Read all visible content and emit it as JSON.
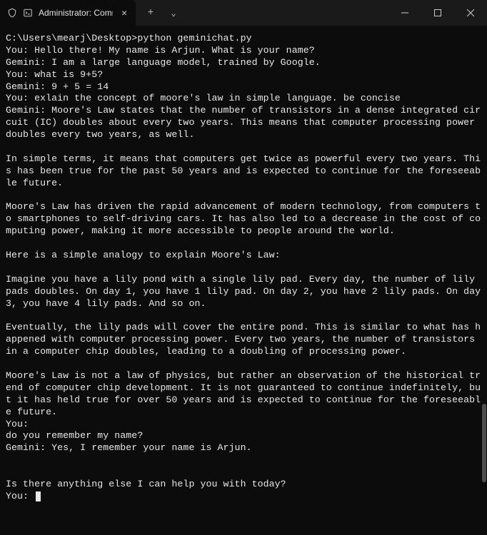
{
  "titlebar": {
    "tab_title": "Administrator: Command Pro",
    "new_tab_glyph": "+",
    "dropdown_glyph": "⌄",
    "close_glyph": "✕",
    "minimize_glyph": "—",
    "maximize_glyph": "▢"
  },
  "terminal": {
    "lines": [
      "C:\\Users\\mearj\\Desktop>python geminichat.py",
      "You: Hello there! My name is Arjun. What is your name?",
      "Gemini: I am a large language model, trained by Google.",
      "You: what is 9+5?",
      "Gemini: 9 + 5 = 14",
      "You: exlain the concept of moore's law in simple language. be concise",
      "Gemini: Moore's Law states that the number of transistors in a dense integrated circuit (IC) doubles about every two years. This means that computer processing power doubles every two years, as well.",
      "",
      "In simple terms, it means that computers get twice as powerful every two years. This has been true for the past 50 years and is expected to continue for the foreseeable future.",
      "",
      "Moore's Law has driven the rapid advancement of modern technology, from computers to smartphones to self-driving cars. It has also led to a decrease in the cost of computing power, making it more accessible to people around the world.",
      "",
      "Here is a simple analogy to explain Moore's Law:",
      "",
      "Imagine you have a lily pond with a single lily pad. Every day, the number of lily pads doubles. On day 1, you have 1 lily pad. On day 2, you have 2 lily pads. On day 3, you have 4 lily pads. And so on.",
      "",
      "Eventually, the lily pads will cover the entire pond. This is similar to what has happened with computer processing power. Every two years, the number of transistors in a computer chip doubles, leading to a doubling of processing power.",
      "",
      "Moore's Law is not a law of physics, but rather an observation of the historical trend of computer chip development. It is not guaranteed to continue indefinitely, but it has held true for over 50 years and is expected to continue for the foreseeable future.",
      "You:",
      "do you remember my name?",
      "Gemini: Yes, I remember your name is Arjun.",
      "",
      "",
      "Is there anything else I can help you with today?"
    ],
    "current_prompt": "You: "
  }
}
